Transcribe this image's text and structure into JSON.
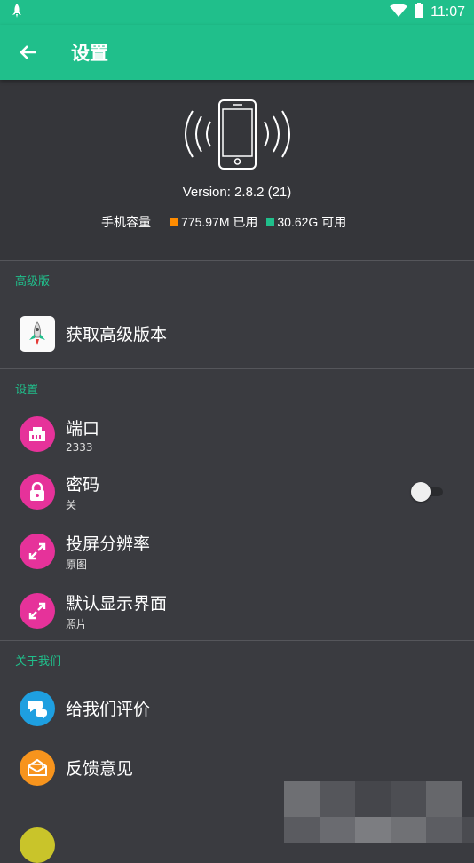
{
  "status_bar": {
    "time": "11:07",
    "left_icon": "rocket-notification-icon",
    "wifi_icon": "wifi-icon",
    "battery_icon": "battery-icon"
  },
  "toolbar": {
    "title": "设置",
    "back_icon": "arrow-back-icon"
  },
  "device": {
    "icon": "phone-vibrate-icon",
    "version": "Version: 2.8.2 (21)",
    "storage_label": "手机容量",
    "used": "775.97M 已用",
    "available": "30.62G 可用",
    "used_color": "#ff8c00",
    "available_color": "#20bf8b"
  },
  "sections": [
    {
      "header": "高级版",
      "items": [
        {
          "title": "获取高级版本",
          "subtitle": "",
          "icon": "rocket-app-icon"
        }
      ]
    },
    {
      "header": "设置",
      "items": [
        {
          "title": "端口",
          "subtitle": "2333",
          "icon": "ethernet-port-icon"
        },
        {
          "title": "密码",
          "subtitle": "关",
          "icon": "lock-icon",
          "toggle": false
        },
        {
          "title": "投屏分辨率",
          "subtitle": "原图",
          "icon": "expand-arrows-icon"
        },
        {
          "title": "默认显示界面",
          "subtitle": "照片",
          "icon": "expand-arrows-icon"
        }
      ]
    },
    {
      "header": "关于我们",
      "items": [
        {
          "title": "给我们评价",
          "subtitle": "",
          "icon": "chat-bubbles-icon"
        },
        {
          "title": "反馈意见",
          "subtitle": "",
          "icon": "envelope-icon"
        }
      ]
    }
  ],
  "colors": {
    "accent": "#20bf8b",
    "pink": "#e6329a",
    "blue": "#1e9fe0",
    "orange": "#f7941d",
    "background": "#3a3b40"
  }
}
